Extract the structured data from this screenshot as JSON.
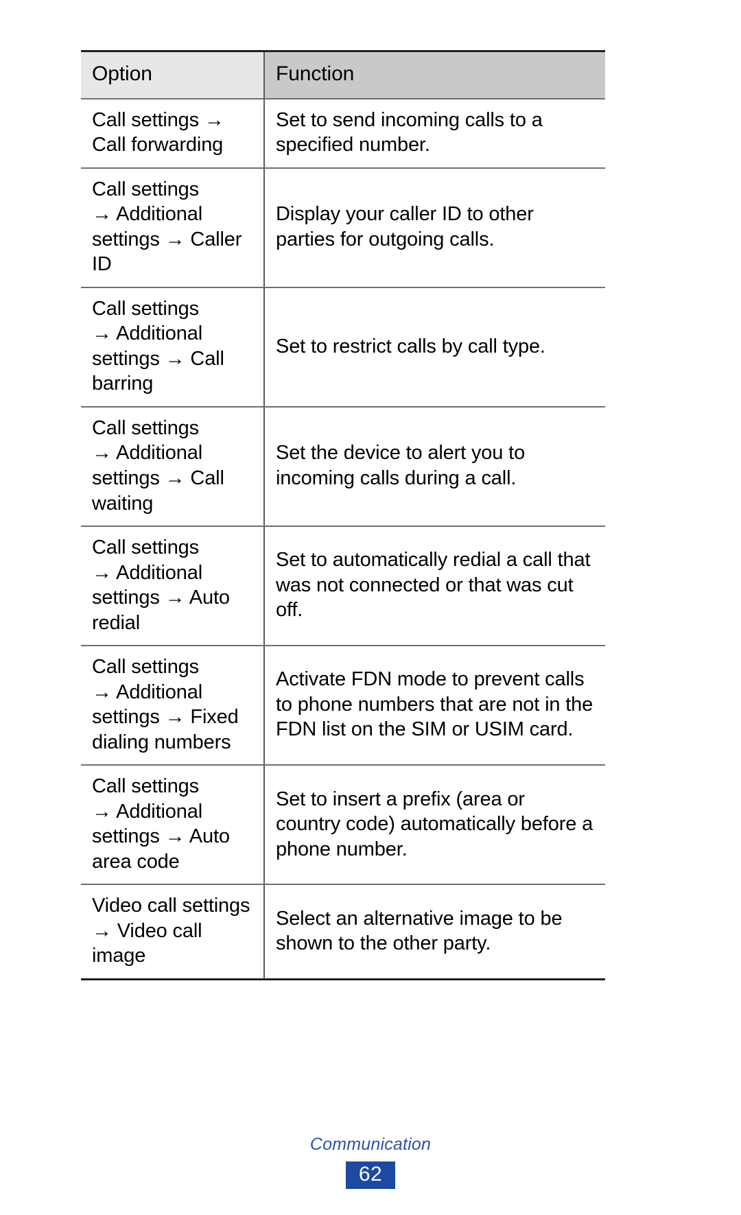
{
  "document": {
    "table": {
      "columns": [
        {
          "key": "option",
          "header": "Option"
        },
        {
          "key": "function",
          "header": "Function"
        }
      ],
      "rows": [
        {
          "option": "Call settings →\nCall forwarding",
          "function": "Set to send incoming calls to a specified number."
        },
        {
          "option": "Call settings\n→ Additional settings → Caller ID",
          "function": "Display your caller ID to other parties for outgoing calls."
        },
        {
          "option": "Call settings\n→ Additional settings → Call barring",
          "function": "Set to restrict calls by call type."
        },
        {
          "option": "Call settings\n→ Additional settings → Call waiting",
          "function": "Set the device to alert you to incoming calls during a call."
        },
        {
          "option": "Call settings\n→ Additional settings → Auto redial",
          "function": "Set to automatically redial a call that was not connected or that was cut off."
        },
        {
          "option": "Call settings\n→ Additional settings → Fixed dialing numbers",
          "function": "Activate FDN mode to prevent calls to phone numbers that are not in the FDN list on the SIM or USIM card."
        },
        {
          "option": "Call settings\n→ Additional settings → Auto area code",
          "function": "Set to insert a prefix (area or country code) automatically before a phone number."
        },
        {
          "option": "Video call settings\n→ Video call image",
          "function": "Select an alternative image to be shown to the other party."
        }
      ]
    },
    "footer": {
      "section_title": "Communication",
      "page_number": "62"
    },
    "colors": {
      "header_option_bg": "#e7e7e7",
      "header_function_bg": "#c9c9c9",
      "rule": "#6d6e71",
      "outer_rule": "#231f20",
      "footer_text": "#2a53a8",
      "page_badge_bg": "#1c4aa2",
      "page_badge_text": "#ffffff"
    }
  }
}
